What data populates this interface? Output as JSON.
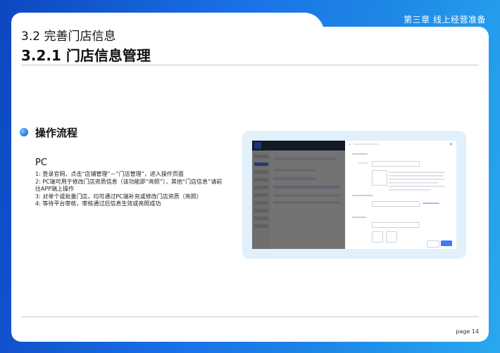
{
  "header": {
    "chapter": "第三章 线上经营准备",
    "section": "3.2 完善门店信息",
    "subsection": "3.2.1 门店信息管理"
  },
  "content": {
    "section_title": "操作流程",
    "platform": "PC",
    "steps": [
      "1: 登录官网，点击“店铺管理”－“门店管理”，进入操作页面",
      "2: PC端可用于修改门店资质信息（该功能即“亮照”），其他“门店信息”请前往APP端上操作",
      "3: 对单个或批量门店，均可通过PC端补充或修改门店资质（亮照）",
      "4: 等待平台审核，审核通过后信息生效或亮照成功"
    ]
  },
  "footer": {
    "page": "page 14"
  },
  "colors": {
    "brand": "#1a73e8",
    "panel": "#e1f0fb"
  }
}
